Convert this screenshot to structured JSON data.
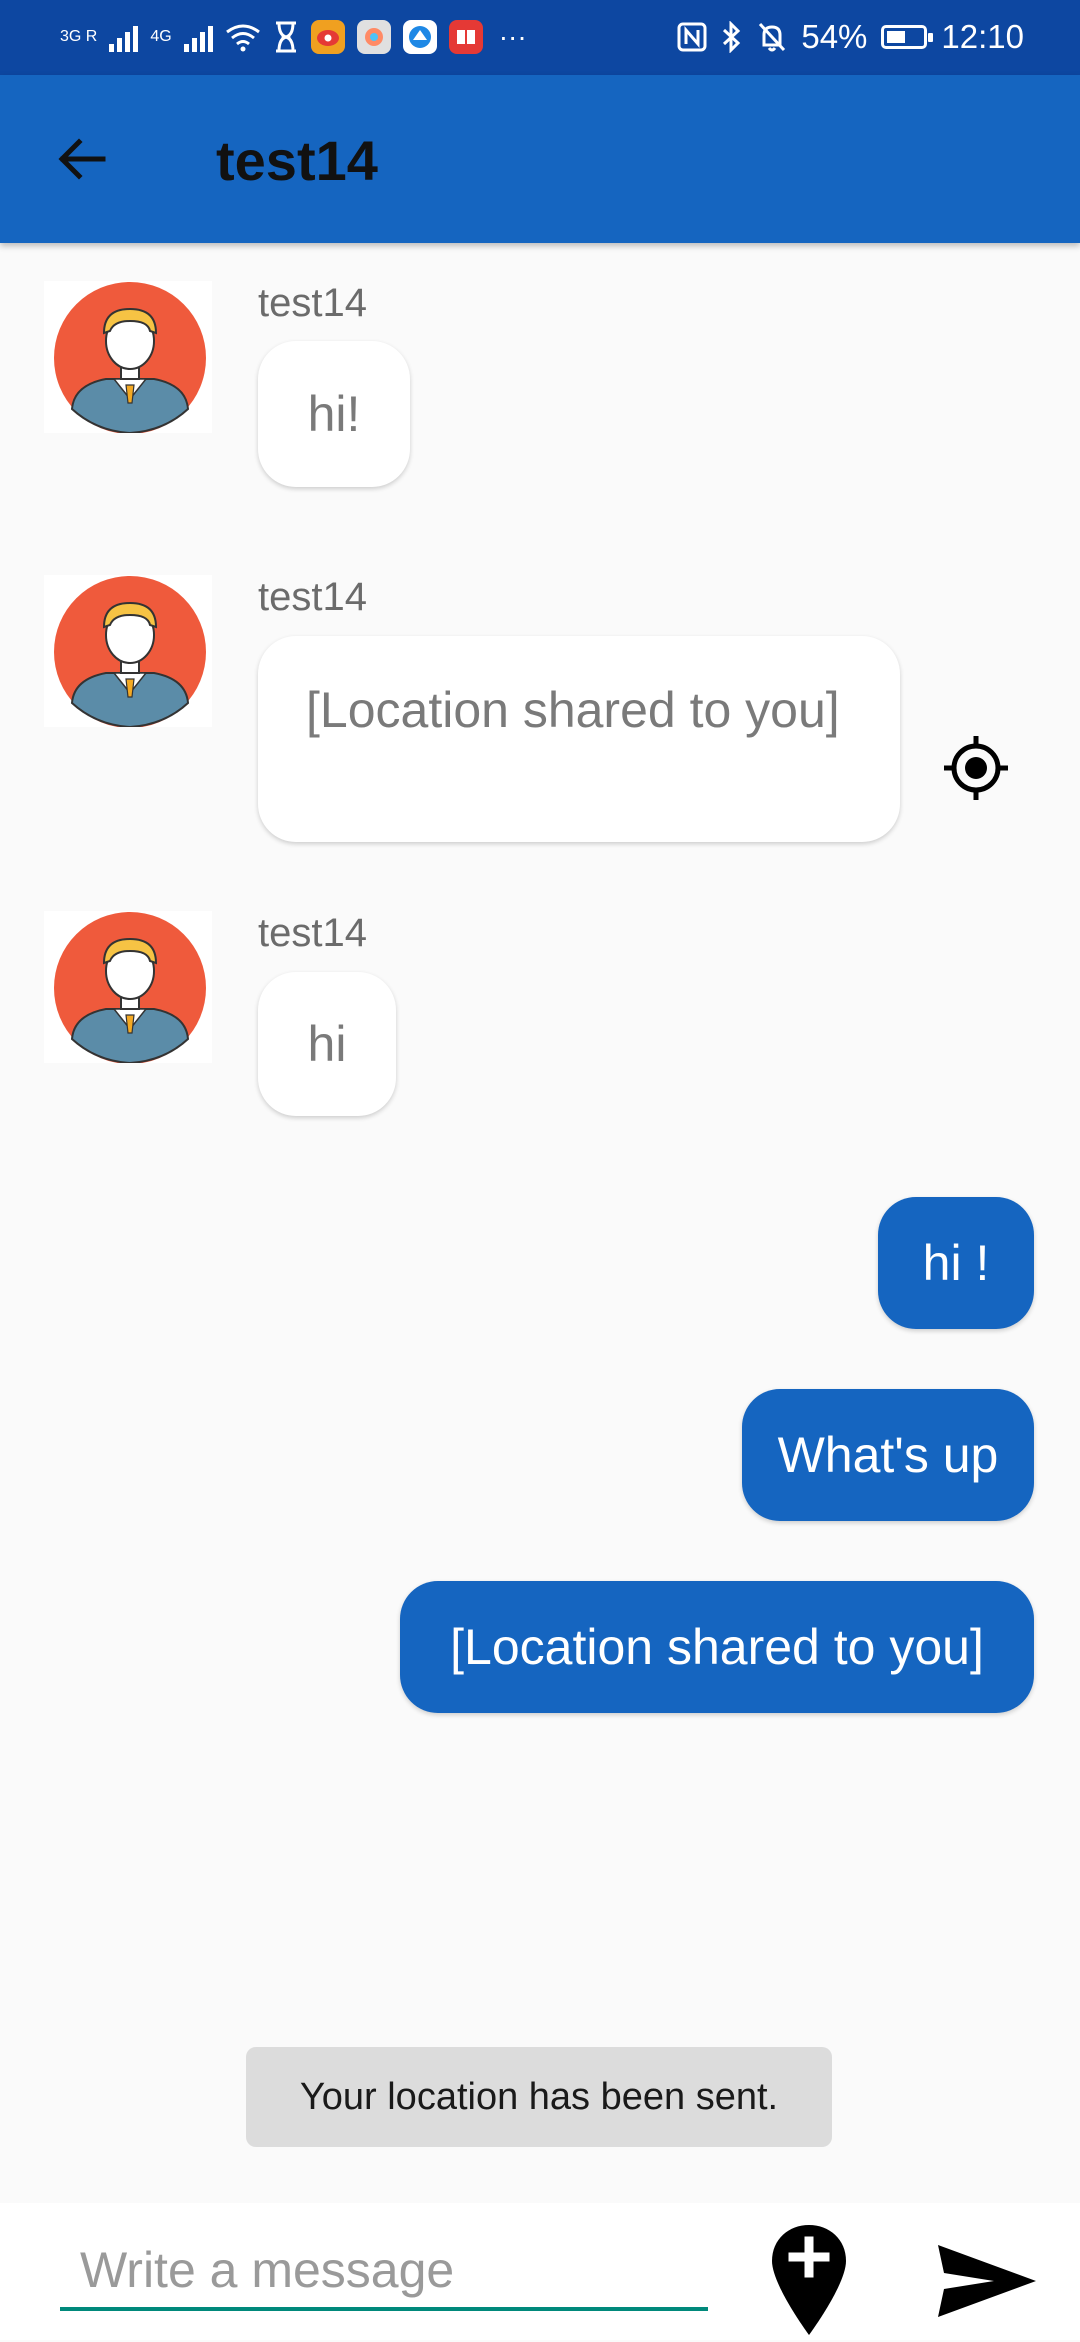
{
  "status_bar": {
    "network_1": "3G R",
    "network_2": "4G",
    "battery": "54%",
    "time": "12:10",
    "battery_level": 0.54
  },
  "header": {
    "title": "test14"
  },
  "incoming_messages": [
    {
      "sender": "test14",
      "text": "hi!"
    },
    {
      "sender": "test14",
      "text": "[Location shared to you]"
    },
    {
      "sender": "test14",
      "text": "hi"
    }
  ],
  "outgoing_messages": [
    {
      "text": "hi !"
    },
    {
      "text": "What's up"
    },
    {
      "text": "[Location shared to you]"
    }
  ],
  "toast": {
    "text": "Your location has been sent."
  },
  "composer": {
    "placeholder": "Write a message"
  },
  "colors": {
    "status_bar": "#0d47a1",
    "app_bar": "#1565c0",
    "outgoing_bubble": "#1565c0",
    "avatar_circle": "#ef5a3c",
    "input_underline": "#00897b"
  }
}
